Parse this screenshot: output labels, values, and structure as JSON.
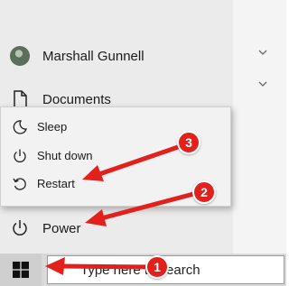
{
  "start_menu": {
    "user": {
      "name": "Marshall Gunnell"
    },
    "documents_label": "Documents",
    "power_label": "Power",
    "icons": {
      "user": "user-avatar",
      "documents": "document-icon",
      "power": "power-icon"
    }
  },
  "power_flyout": {
    "items": [
      {
        "label": "Sleep",
        "icon": "moon-icon"
      },
      {
        "label": "Shut down",
        "icon": "power-icon"
      },
      {
        "label": "Restart",
        "icon": "restart-icon"
      }
    ]
  },
  "taskbar": {
    "start_icon": "windows-logo-icon",
    "search_placeholder": "Type here to search"
  },
  "annotations": {
    "badges": [
      "1",
      "2",
      "3"
    ],
    "color": "#e3211c"
  },
  "colors": {
    "menu_bg": "#ebebeb",
    "flyout_bg": "#f2f2f2",
    "taskbar_bg": "#d9d9d9",
    "annotation_red": "#e3211c"
  }
}
